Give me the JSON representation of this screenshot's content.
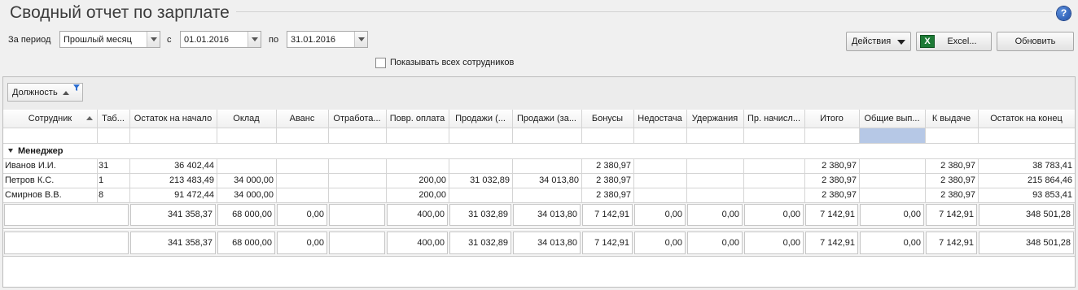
{
  "window": {
    "title": "Сводный отчет по зарплате",
    "help_icon": "question-circle-icon",
    "help_glyph": "?"
  },
  "filters": {
    "period_label": "За период",
    "period_value": "Прошлый месяц",
    "from_label": "с",
    "from_date": "01.01.2016",
    "to_label": "по",
    "to_date": "31.01.2016",
    "show_all_label": "Показывать всех сотрудников",
    "show_all_checked": false
  },
  "toolbar": {
    "actions_label": "Действия",
    "excel_label": "Excel...",
    "excel_icon": "excel-icon",
    "excel_glyph": "X",
    "refresh_label": "Обновить"
  },
  "grouping": {
    "field_label": "Должность"
  },
  "table": {
    "columns": [
      "Сотрудник",
      "Таб...",
      "Остаток на начало",
      "Оклад",
      "Аванс",
      "Отработа...",
      "Повр. оплата",
      "Продажи (...",
      "Продажи (за...",
      "Бонусы",
      "Недостача",
      "Удержания",
      "Пр. начисл...",
      "Итого",
      "Общие вып...",
      "К выдаче",
      "Остаток на конец"
    ],
    "group_name": "Менеджер",
    "rows": [
      [
        "Иванов И.И.",
        "31",
        "36 402,44",
        "",
        "",
        "",
        "",
        "",
        "",
        "2 380,97",
        "",
        "",
        "",
        "2 380,97",
        "",
        "2 380,97",
        "38 783,41"
      ],
      [
        "Петров К.С.",
        "1",
        "213 483,49",
        "34 000,00",
        "",
        "",
        "200,00",
        "31 032,89",
        "34 013,80",
        "2 380,97",
        "",
        "",
        "",
        "2 380,97",
        "",
        "2 380,97",
        "215 864,46"
      ],
      [
        "Смирнов В.В.",
        "8",
        "91 472,44",
        "34 000,00",
        "",
        "",
        "200,00",
        "",
        "",
        "2 380,97",
        "",
        "",
        "",
        "2 380,97",
        "",
        "2 380,97",
        "93 853,41"
      ]
    ],
    "group_totals": [
      "",
      "",
      "341 358,37",
      "68 000,00",
      "0,00",
      "",
      "400,00",
      "31 032,89",
      "34 013,80",
      "7 142,91",
      "0,00",
      "0,00",
      "0,00",
      "7 142,91",
      "0,00",
      "7 142,91",
      "348 501,28"
    ],
    "grand_totals": [
      "",
      "",
      "341 358,37",
      "68 000,00",
      "0,00",
      "",
      "400,00",
      "31 032,89",
      "34 013,80",
      "7 142,91",
      "0,00",
      "0,00",
      "0,00",
      "7 142,91",
      "0,00",
      "7 142,91",
      "348 501,28"
    ]
  },
  "colors": {
    "selected_filter_cell": "#b6c8e6",
    "excel_green": "#1d7a36",
    "help_blue": "#2a5fb8"
  }
}
